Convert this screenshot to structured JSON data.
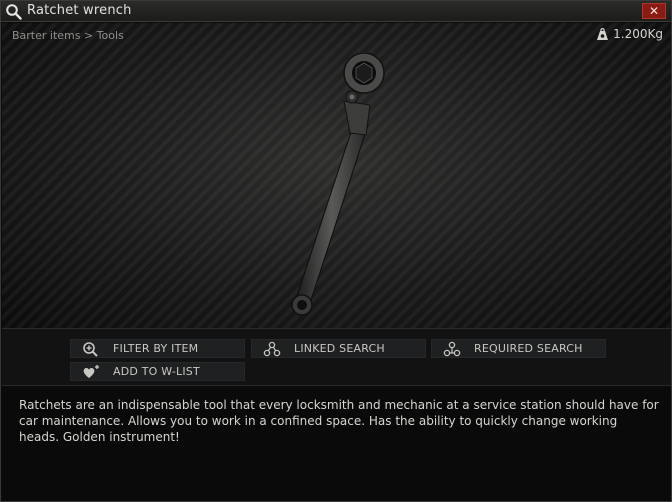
{
  "window": {
    "title": "Ratchet wrench",
    "close_label": "✕"
  },
  "preview": {
    "breadcrumb": "Barter items > Tools",
    "weight": "1.200Kg"
  },
  "actions": {
    "filter_by_item": "FILTER BY ITEM",
    "linked_search": "LINKED SEARCH",
    "required_search": "REQUIRED SEARCH",
    "add_to_wlist": "ADD TO W-LIST"
  },
  "description": "Ratchets are an indispensable tool that every locksmith and mechanic at a service station should have for car maintenance. Allows you to work in a confined space. Has the ability to quickly change working heads. Golden instrument!",
  "icons": {
    "title": "search-icon",
    "weight": "weight-icon",
    "filter": "magnifier-plus-icon",
    "linked": "linked-nodes-icon",
    "required": "required-nodes-icon",
    "wishlist": "heart-plus-icon"
  },
  "colors": {
    "close_button": "#8a1b14",
    "button_bg": "#1f2022",
    "text": "#d6d6d1"
  }
}
